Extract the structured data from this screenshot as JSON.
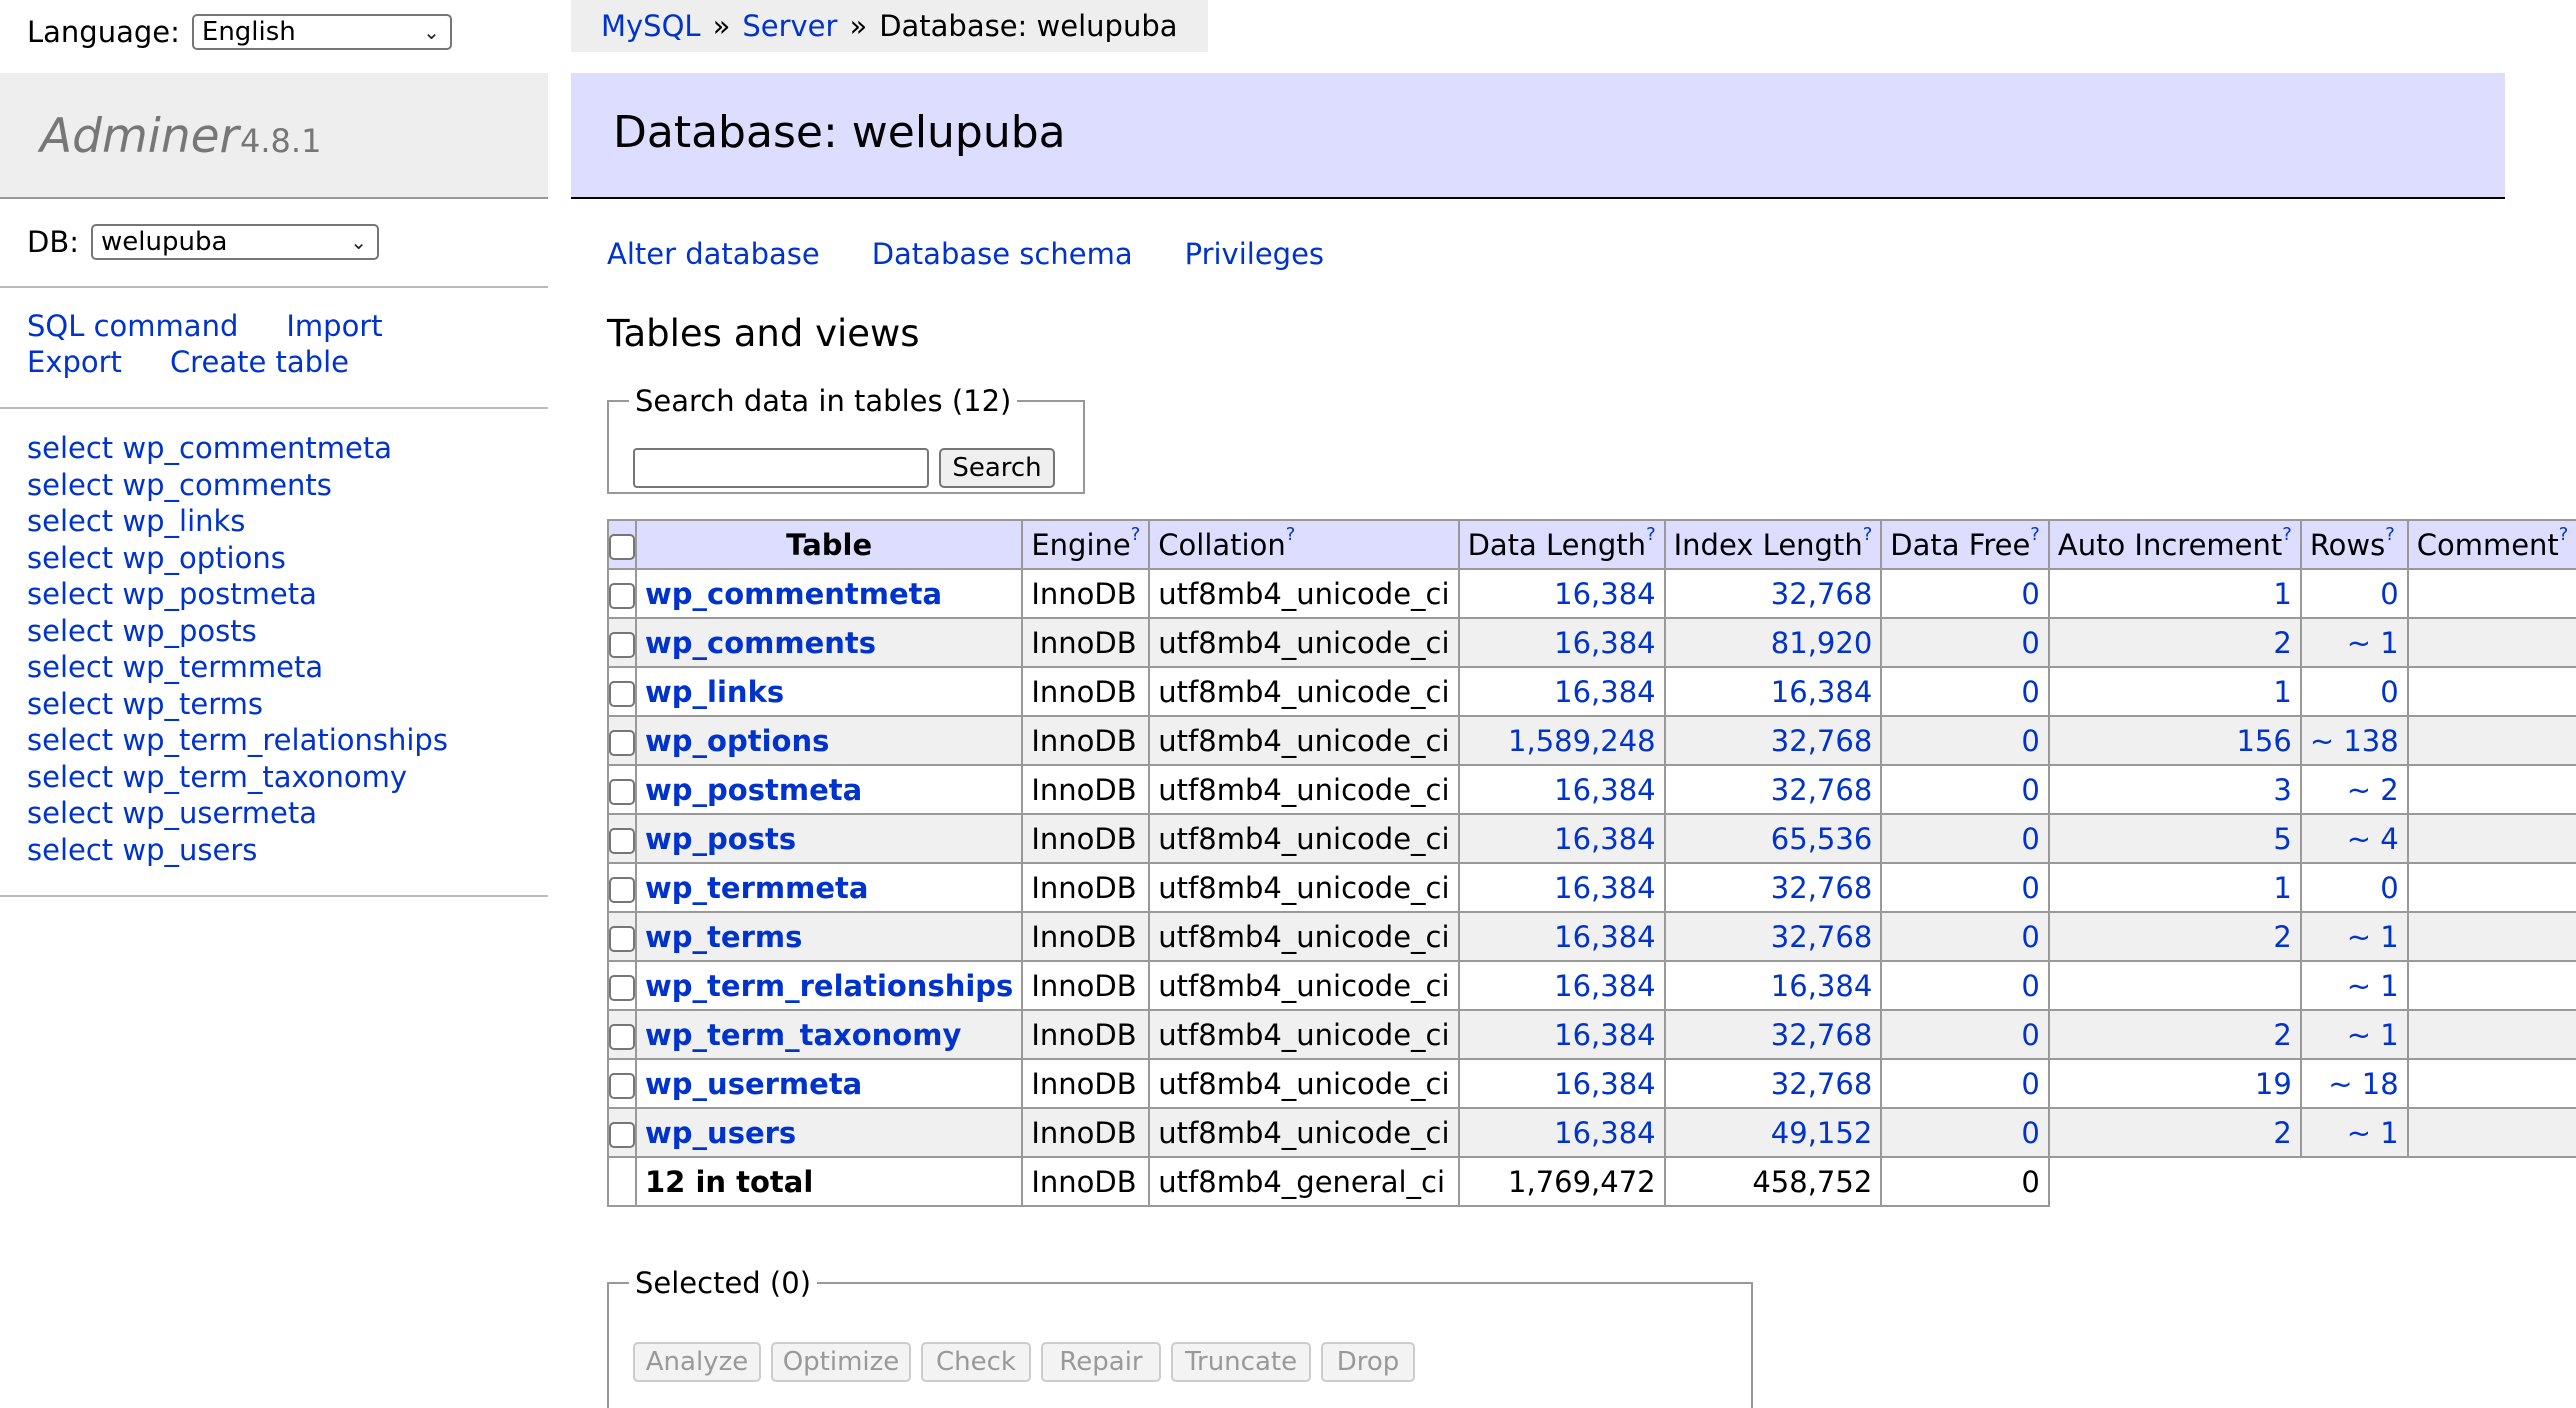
{
  "sidebar": {
    "language_label": "Language:",
    "language_value": "English",
    "app_name": "Adminer",
    "app_version": "4.8.1",
    "db_label": "DB:",
    "db_value": "welupuba",
    "links": {
      "sql_command": "SQL command",
      "import": "Import",
      "export": "Export",
      "create_table": "Create table"
    },
    "tables": [
      "select wp_commentmeta",
      "select wp_comments",
      "select wp_links",
      "select wp_options",
      "select wp_postmeta",
      "select wp_posts",
      "select wp_termmeta",
      "select wp_terms",
      "select wp_term_relationships",
      "select wp_term_taxonomy",
      "select wp_usermeta",
      "select wp_users"
    ]
  },
  "breadcrumb": {
    "mysql": "MySQL",
    "sep": "»",
    "server": "Server",
    "current": "Database: welupuba"
  },
  "header": {
    "title": "Database: welupuba"
  },
  "actions": {
    "alter": "Alter database",
    "schema": "Database schema",
    "privileges": "Privileges"
  },
  "tables_section": {
    "title": "Tables and views",
    "search_legend": "Search data in tables (12)",
    "search_value": "",
    "search_button": "Search"
  },
  "table": {
    "headers": {
      "table": "Table",
      "engine": "Engine",
      "collation": "Collation",
      "data_length": "Data Length",
      "index_length": "Index Length",
      "data_free": "Data Free",
      "auto_increment": "Auto Increment",
      "rows": "Rows",
      "comment": "Comment",
      "help": "?"
    },
    "rows": [
      {
        "name": "wp_commentmeta",
        "engine": "InnoDB",
        "collation": "utf8mb4_unicode_ci",
        "data_length": "16,384",
        "index_length": "32,768",
        "data_free": "0",
        "auto_increment": "1",
        "rows": "0",
        "comment": ""
      },
      {
        "name": "wp_comments",
        "engine": "InnoDB",
        "collation": "utf8mb4_unicode_ci",
        "data_length": "16,384",
        "index_length": "81,920",
        "data_free": "0",
        "auto_increment": "2",
        "rows": "~ 1",
        "comment": ""
      },
      {
        "name": "wp_links",
        "engine": "InnoDB",
        "collation": "utf8mb4_unicode_ci",
        "data_length": "16,384",
        "index_length": "16,384",
        "data_free": "0",
        "auto_increment": "1",
        "rows": "0",
        "comment": ""
      },
      {
        "name": "wp_options",
        "engine": "InnoDB",
        "collation": "utf8mb4_unicode_ci",
        "data_length": "1,589,248",
        "index_length": "32,768",
        "data_free": "0",
        "auto_increment": "156",
        "rows": "~ 138",
        "comment": ""
      },
      {
        "name": "wp_postmeta",
        "engine": "InnoDB",
        "collation": "utf8mb4_unicode_ci",
        "data_length": "16,384",
        "index_length": "32,768",
        "data_free": "0",
        "auto_increment": "3",
        "rows": "~ 2",
        "comment": ""
      },
      {
        "name": "wp_posts",
        "engine": "InnoDB",
        "collation": "utf8mb4_unicode_ci",
        "data_length": "16,384",
        "index_length": "65,536",
        "data_free": "0",
        "auto_increment": "5",
        "rows": "~ 4",
        "comment": ""
      },
      {
        "name": "wp_termmeta",
        "engine": "InnoDB",
        "collation": "utf8mb4_unicode_ci",
        "data_length": "16,384",
        "index_length": "32,768",
        "data_free": "0",
        "auto_increment": "1",
        "rows": "0",
        "comment": ""
      },
      {
        "name": "wp_terms",
        "engine": "InnoDB",
        "collation": "utf8mb4_unicode_ci",
        "data_length": "16,384",
        "index_length": "32,768",
        "data_free": "0",
        "auto_increment": "2",
        "rows": "~ 1",
        "comment": ""
      },
      {
        "name": "wp_term_relationships",
        "engine": "InnoDB",
        "collation": "utf8mb4_unicode_ci",
        "data_length": "16,384",
        "index_length": "16,384",
        "data_free": "0",
        "auto_increment": "",
        "rows": "~ 1",
        "comment": ""
      },
      {
        "name": "wp_term_taxonomy",
        "engine": "InnoDB",
        "collation": "utf8mb4_unicode_ci",
        "data_length": "16,384",
        "index_length": "32,768",
        "data_free": "0",
        "auto_increment": "2",
        "rows": "~ 1",
        "comment": ""
      },
      {
        "name": "wp_usermeta",
        "engine": "InnoDB",
        "collation": "utf8mb4_unicode_ci",
        "data_length": "16,384",
        "index_length": "32,768",
        "data_free": "0",
        "auto_increment": "19",
        "rows": "~ 18",
        "comment": ""
      },
      {
        "name": "wp_users",
        "engine": "InnoDB",
        "collation": "utf8mb4_unicode_ci",
        "data_length": "16,384",
        "index_length": "49,152",
        "data_free": "0",
        "auto_increment": "2",
        "rows": "~ 1",
        "comment": ""
      }
    ],
    "total": {
      "label": "12 in total",
      "engine": "InnoDB",
      "collation": "utf8mb4_general_ci",
      "data_length": "1,769,472",
      "index_length": "458,752",
      "data_free": "0"
    }
  },
  "selected": {
    "legend": "Selected (0)",
    "buttons": [
      "Analyze",
      "Optimize",
      "Check",
      "Repair",
      "Truncate",
      "Drop"
    ]
  },
  "colors": {
    "link": "#0033cc",
    "header_bg": "#ddddff",
    "sidebar_bg": "#eeeeee"
  }
}
